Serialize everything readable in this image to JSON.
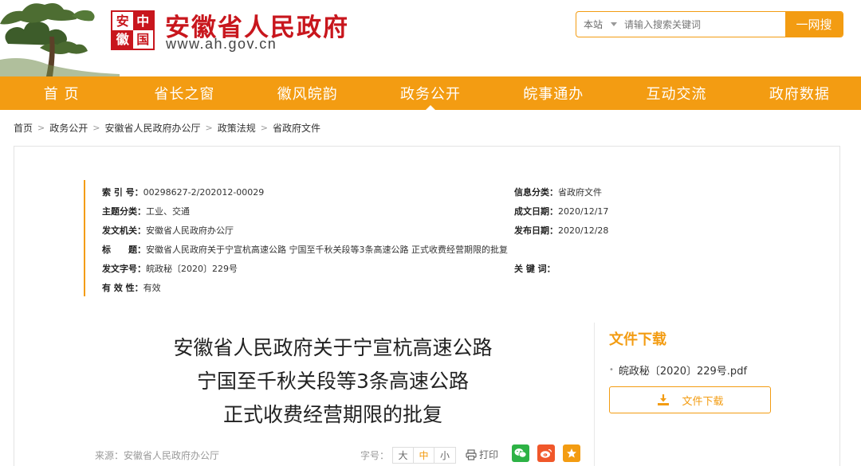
{
  "header": {
    "seal_chars": [
      "安",
      "中",
      "徽",
      "国"
    ],
    "site_title": "安徽省人民政府",
    "site_domain": "www.ah.gov.cn"
  },
  "search": {
    "scope": "本站",
    "placeholder": "请输入搜索关键词",
    "button": "一网搜"
  },
  "nav": {
    "items": [
      "首 页",
      "省长之窗",
      "徽风皖韵",
      "政务公开",
      "皖事通办",
      "互动交流",
      "政府数据"
    ],
    "active": "政务公开"
  },
  "breadcrumb": [
    "首页",
    "政务公开",
    "安徽省人民政府办公厅",
    "政策法规",
    "省政府文件"
  ],
  "meta": {
    "index_label": "索 引 号：",
    "index_value": "00298627-2/202012-00029",
    "category_label": "信息分类：",
    "category_value": "省政府文件",
    "topic_label": "主题分类：",
    "topic_value": "工业、交通",
    "created_label": "成文日期：",
    "created_value": "2020/12/17",
    "issuer_label": "发文机关：",
    "issuer_value": "安徽省人民政府办公厅",
    "published_label": "发布日期：",
    "published_value": "2020/12/28",
    "title_label": "标　　题：",
    "title_value": "安徽省人民政府关于宁宣杭高速公路 宁国至千秋关段等3条高速公路 正式收费经营期限的批复",
    "docno_label": "发文字号：",
    "docno_value": "皖政秘〔2020〕229号",
    "keywords_label": "关 键 词：",
    "keywords_value": "",
    "validity_label": "有 效 性：",
    "validity_value": "有效"
  },
  "document": {
    "title_line1": "安徽省人民政府关于宁宣杭高速公路",
    "title_line2": "宁国至千秋关段等3条高速公路",
    "title_line3": "正式收费经营期限的批复"
  },
  "toolbar": {
    "source": "来源：安徽省人民政府办公厅",
    "fontsize_label": "字号：",
    "font_large": "大",
    "font_medium": "中",
    "font_small": "小",
    "print_label": "打印"
  },
  "download": {
    "heading": "文件下载",
    "file_name": "皖政秘〔2020〕229号.pdf",
    "button_label": "文件下载"
  },
  "colors": {
    "brand_orange": "#f39c12",
    "brand_red": "#c8161d",
    "wechat_green": "#2db245",
    "weibo_orange": "#f0572a",
    "favorite_orange": "#f39c12"
  }
}
